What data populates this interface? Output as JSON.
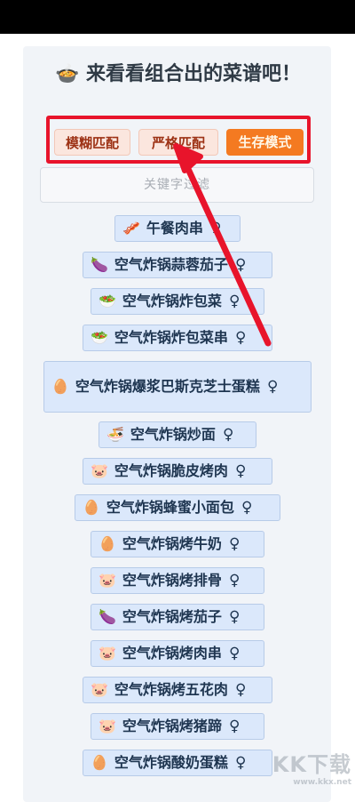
{
  "title": "🍲 来看看组合出的菜谱吧！",
  "modes": {
    "fuzzy": "模糊匹配",
    "strict": "严格匹配",
    "survival": "生存模式"
  },
  "search": {
    "placeholder": "关键字过滤"
  },
  "recipes": [
    {
      "emoji": "🥓",
      "name": "午餐肉串"
    },
    {
      "emoji": "🍆",
      "name": "空气炸锅蒜蓉茄子"
    },
    {
      "emoji": "🥗",
      "name": "空气炸锅炸包菜"
    },
    {
      "emoji": "🥗",
      "name": "空气炸锅炸包菜串"
    },
    {
      "emoji": "🥚",
      "name": "空气炸锅爆浆巴斯克芝士蛋糕"
    },
    {
      "emoji": "🍜",
      "name": "空气炸锅炒面"
    },
    {
      "emoji": "🐷",
      "name": "空气炸锅脆皮烤肉"
    },
    {
      "emoji": "🥚",
      "name": "空气炸锅蜂蜜小面包"
    },
    {
      "emoji": "🥚",
      "name": "空气炸锅烤牛奶"
    },
    {
      "emoji": "🐷",
      "name": "空气炸锅烤排骨"
    },
    {
      "emoji": "🍆",
      "name": "空气炸锅烤茄子"
    },
    {
      "emoji": "🐷",
      "name": "空气炸锅烤肉串"
    },
    {
      "emoji": "🐷",
      "name": "空气炸锅烤五花肉"
    },
    {
      "emoji": "🐷",
      "name": "空气炸锅烤猪蹄"
    },
    {
      "emoji": "🥚",
      "name": "空气炸锅酸奶蛋糕"
    }
  ],
  "female_symbol": "♀",
  "watermark": {
    "brand": "KK下载",
    "url": "www.kkx.net"
  }
}
